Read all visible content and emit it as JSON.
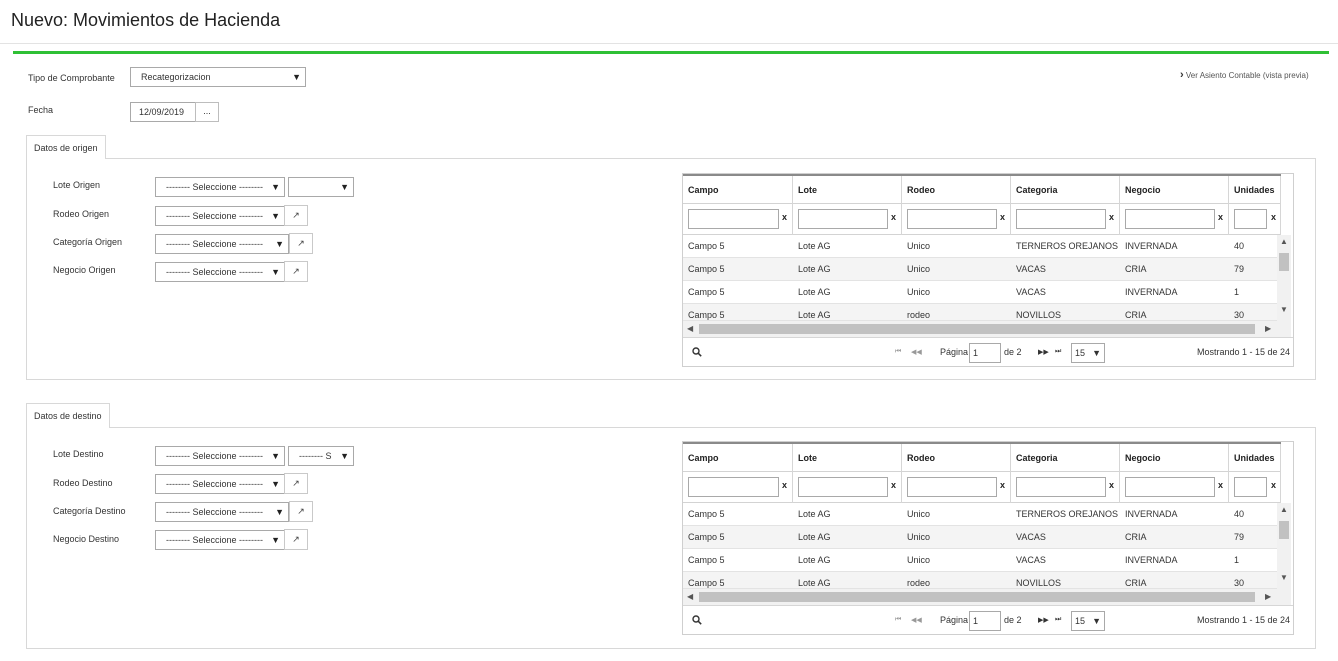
{
  "page": {
    "title": "Nuevo: Movimientos de Hacienda",
    "accent_color": "#2fc035"
  },
  "header": {
    "tipo_label": "Tipo de Comprobante",
    "tipo_value": "Recategorizacion",
    "fecha_label": "Fecha",
    "fecha_value": "12/09/2019",
    "fecha_btn": "...",
    "ver_asiento": "Ver Asiento Contable (vista previa)"
  },
  "origen": {
    "tab": "Datos de origen",
    "fields": [
      {
        "label": "Lote Origen",
        "value": "-------- Seleccione --------"
      },
      {
        "label": "Rodeo Origen",
        "value": "-------- Seleccione --------"
      },
      {
        "label": "Categoría Origen",
        "value": "-------- Seleccione --------"
      },
      {
        "label": "Negocio Origen",
        "value": "-------- Seleccione --------"
      }
    ],
    "lote_extra_value": ""
  },
  "destino": {
    "tab": "Datos de destino",
    "fields": [
      {
        "label": "Lote Destino",
        "value": "-------- Seleccione --------"
      },
      {
        "label": "Rodeo Destino",
        "value": "-------- Seleccione --------"
      },
      {
        "label": "Categoría Destino",
        "value": "-------- Seleccione --------"
      },
      {
        "label": "Negocio Destino",
        "value": "-------- Seleccione --------"
      }
    ],
    "lote_extra_value": "-------- S"
  },
  "grid": {
    "columns": [
      "Campo",
      "Lote",
      "Rodeo",
      "Categoria",
      "Negocio",
      "Unidades"
    ],
    "filter_clear": "x",
    "rows": [
      [
        "Campo 5",
        "Lote AG",
        "Unico",
        "TERNEROS OREJANOS",
        "INVERNADA",
        "40"
      ],
      [
        "Campo 5",
        "Lote AG",
        "Unico",
        "VACAS",
        "CRIA",
        "79"
      ],
      [
        "Campo 5",
        "Lote AG",
        "Unico",
        "VACAS",
        "INVERNADA",
        "1"
      ],
      [
        "Campo 5",
        "Lote AG",
        "rodeo",
        "NOVILLOS",
        "CRIA",
        "30"
      ]
    ],
    "pager": {
      "page_label": "Página",
      "page_value": "1",
      "of_label": "de 2",
      "page_size": "15",
      "showing": "Mostrando 1 - 15 de 24"
    }
  },
  "icons": {
    "dropdown": "▼",
    "external": "↗",
    "search": "search-icon",
    "first": "⏮",
    "prev": "◀◀",
    "next": "▶▶",
    "last": "⏭",
    "chevron": "›"
  }
}
